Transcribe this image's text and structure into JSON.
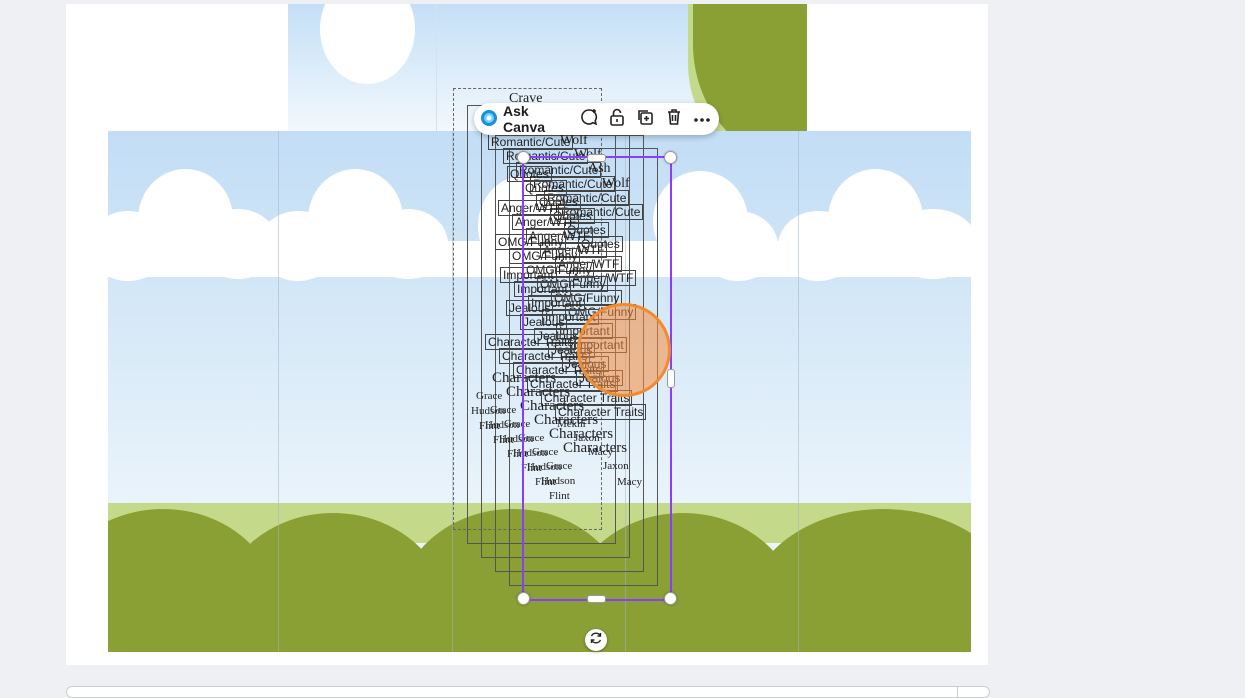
{
  "toolbar": {
    "ask_canva_label": "Ask Canva",
    "icons": [
      "canva-assistant-icon",
      "add-comment-icon",
      "lock-icon",
      "duplicate-icon",
      "delete-icon",
      "more-icon"
    ]
  },
  "stack_titles": {
    "crave": "Crave"
  },
  "label_texts": {
    "romantic_cute": "Romantic/Cute",
    "quotes": "Quotes",
    "anger_wtf": "Anger/WTF",
    "omg_funny": "OMG/Funny",
    "important": "Important",
    "jealous": "Jealous",
    "character_traits": "Character Traits",
    "characters": "Characters",
    "wolf": "Wolf",
    "ash": "Ash",
    "grace": "Grace",
    "hudson": "Hudson",
    "flint": "Flint",
    "macy": "Macy",
    "mekhi": "Mekhi",
    "jaxon": "Jaxon"
  },
  "colors": {
    "selection": "#8b3dff",
    "canvas_bg": "#eff0f3",
    "cursor": "#f28b2c",
    "grass": "#8aa035",
    "grass_light": "#c5d98a"
  }
}
